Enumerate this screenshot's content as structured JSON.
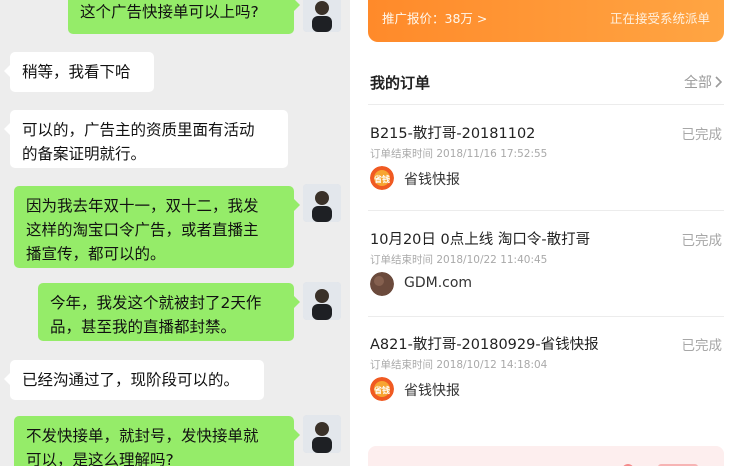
{
  "chat": {
    "messages": [
      {
        "side": "out",
        "text": "这个广告快接单可以上吗?"
      },
      {
        "side": "in",
        "text": "稍等，我看下哈"
      },
      {
        "side": "in",
        "text": "可以的，广告主的资质里面有活动\n的备案证明就行。"
      },
      {
        "side": "out",
        "text": "因为我去年双十一，双十二，我发\n这样的淘宝口令广告，或者直播主\n播宣传，都可以的。"
      },
      {
        "side": "out",
        "text": "今年，我发这个就被封了2天作\n品，甚至我的直播都封禁。"
      },
      {
        "side": "in",
        "text": "已经沟通过了，现阶段可以的。"
      },
      {
        "side": "out",
        "text": "不发快接单，就封号，发快接单就\n可以，是这么理解吗?"
      }
    ]
  },
  "promo": {
    "label": "推广报价：38万 >",
    "status": "正在接受系统派单"
  },
  "orders": {
    "title": "我的订单",
    "all_label": "全部",
    "items": [
      {
        "name": "B215-散打哥-20181102",
        "status": "已完成",
        "time": "订单结束时间 2018/11/16 17:52:55",
        "shop": "省钱快报",
        "logo": "shengqian-logo"
      },
      {
        "name": "10月20日 0点上线 淘口令-散打哥",
        "status": "已完成",
        "time": "订单结束时间 2018/10/22 11:40:45",
        "shop": "GDM.com",
        "logo": "gdm-logo"
      },
      {
        "name": "A821-散打哥-20180929-省钱快报",
        "status": "已完成",
        "time": "订单结束时间 2018/10/12 14:18:04",
        "shop": "省钱快报",
        "logo": "shengqian-logo"
      }
    ]
  },
  "logos": {
    "shengqian_text": "省钱"
  },
  "colors": {
    "bubble_out": "#95ec69",
    "bubble_in": "#ffffff",
    "chat_bg": "#ededed",
    "promo_orange": "#ff8a2a",
    "status_gray": "#a7a7a7"
  }
}
